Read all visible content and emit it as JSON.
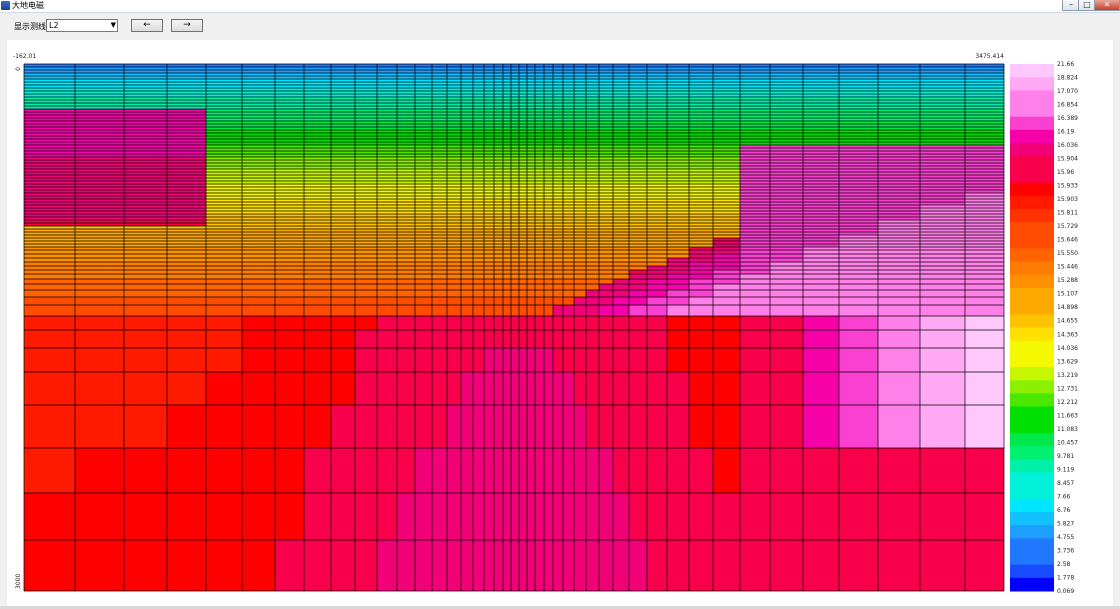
{
  "window": {
    "title": "大地电磁",
    "minimize": "–",
    "maximize": "□",
    "close": "✕"
  },
  "toolbar": {
    "label": "显示测线",
    "selected_line": "L2",
    "prev_label": "←",
    "next_label": "→"
  },
  "colors": {
    "window_bg": "#f0f0f0",
    "palette": [
      "#0000ff",
      "#1a4cff",
      "#1f78ff",
      "#1f9fff",
      "#12c2ff",
      "#00e6ff",
      "#00f0d8",
      "#00f0a8",
      "#00f070",
      "#00e84a",
      "#00e000",
      "#4ce800",
      "#8cf000",
      "#c8f800",
      "#f4f800",
      "#ffe000",
      "#ffc400",
      "#ffa800",
      "#ff9000",
      "#ff7c00",
      "#ff6400",
      "#ff4c00",
      "#ff3200",
      "#ff1a00",
      "#ff0000",
      "#f8004c",
      "#f20078",
      "#f600a8",
      "#fa40d0",
      "#ff80e8",
      "#ffa8f4",
      "#ffc8fc"
    ]
  },
  "chart_data": {
    "type": "heatmap",
    "x_start_label": "-162.01",
    "x_end_label": "3475.414",
    "y_top_label": "0",
    "y_bottom_label": "3000",
    "color_scale_labels": [
      "21.66",
      "18.824",
      "17.070",
      "16.854",
      "16.389",
      "16.19",
      "16.036",
      "15.904",
      "15.96",
      "15.933",
      "15.903",
      "15.811",
      "15.729",
      "15.646",
      "15.550",
      "15.446",
      "15.288",
      "15.107",
      "14.898",
      "14.655",
      "14.363",
      "14.036",
      "13.629",
      "13.219",
      "12.731",
      "12.212",
      "11.663",
      "11.083",
      "10.457",
      "9.781",
      "9.119",
      "8.457",
      "7.66",
      "6.76",
      "5.827",
      "4.755",
      "3.736",
      "2.58",
      "1.778",
      "0.069"
    ],
    "x_bounds": [
      24,
      75,
      124,
      167,
      206,
      242,
      275,
      304,
      331,
      355,
      377,
      397,
      415,
      432,
      447,
      461,
      473,
      484,
      494,
      503,
      511,
      519,
      527,
      535,
      544,
      553,
      563,
      574,
      586,
      599,
      613,
      629,
      647,
      667,
      689,
      713,
      740,
      770,
      803,
      839,
      878,
      920,
      965,
      1004
    ],
    "y_bounds": [
      64,
      67,
      70,
      73,
      76,
      79,
      82,
      85,
      88,
      91,
      94,
      97,
      100,
      103,
      106,
      109,
      112,
      115,
      118,
      121,
      124,
      127,
      130,
      133,
      136,
      139,
      142,
      145,
      148,
      151,
      154,
      157,
      160,
      163,
      166,
      169,
      172,
      175,
      178,
      181,
      184,
      187,
      190,
      193,
      196,
      199,
      202,
      205,
      208,
      211,
      214,
      217,
      220,
      223,
      226,
      229,
      232,
      235,
      238,
      241,
      244,
      247,
      250,
      254,
      258,
      262,
      266,
      270,
      274,
      279,
      284,
      290,
      297,
      305,
      316,
      330,
      348,
      372,
      405,
      448,
      493,
      540,
      591
    ]
  }
}
